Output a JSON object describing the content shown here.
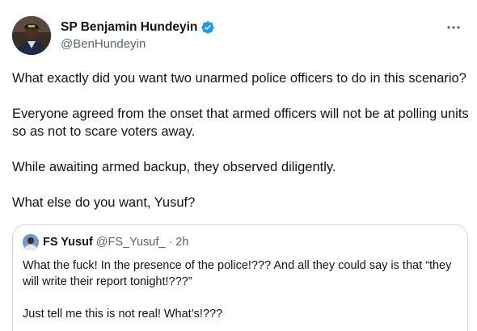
{
  "author": {
    "display_name": "SP Benjamin Hundeyin",
    "handle": "@BenHundeyin",
    "verified": true
  },
  "tweet": {
    "paragraphs": [
      "What exactly did you want two unarmed police officers to do in this scenario?",
      "Everyone agreed from the onset that armed officers will not be at polling units so as not to scare voters away.",
      "While awaiting armed backup, they observed diligently.",
      "What else do you want, Yusuf?"
    ]
  },
  "quoted_tweet": {
    "display_name": "FS Yusuf",
    "handle": "@FS_Yusuf_",
    "separator": "·",
    "time": "2h",
    "paragraphs": [
      "What the fuck! In the presence of the police!??? And all they could say is that “they will write their report tonight!???”",
      "Just tell me this is not real! What’s!???"
    ]
  },
  "colors": {
    "text_primary": "#0f1419",
    "text_secondary": "#536471",
    "verified_blue": "#1d9bf0",
    "border": "#cfd9de"
  },
  "icons": {
    "verified": "verified-badge-icon",
    "more": "more-options-icon"
  }
}
